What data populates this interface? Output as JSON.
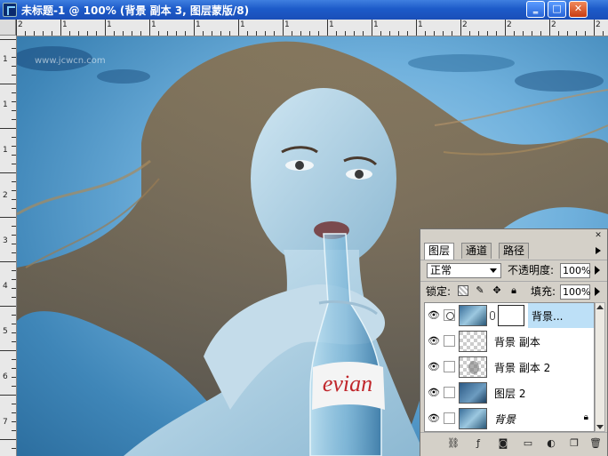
{
  "window": {
    "title": "未标题-1 @ 100% (背景 副本 3, 图层蒙版/8)",
    "buttons": {
      "minimize": "‗",
      "maximize": "□",
      "close": "✕"
    }
  },
  "watermark": "www.jcwcn.com",
  "rulers": {
    "top_labels": [
      "2",
      "1",
      "1",
      "1",
      "1",
      "1",
      "1",
      "1",
      "1",
      "1",
      "2",
      "2",
      "2",
      "2"
    ],
    "left_labels": [
      "1",
      "1",
      "1",
      "2",
      "3",
      "4",
      "5",
      "6",
      "7"
    ]
  },
  "canvas": {
    "photo_text": "evian"
  },
  "layers_panel": {
    "tabs": [
      "图层",
      "通道",
      "路径"
    ],
    "blend_mode": "正常",
    "opacity_label": "不透明度:",
    "opacity_value": "100%",
    "lock_label": "锁定:",
    "fill_label": "填充:",
    "fill_value": "100%",
    "layers": [
      {
        "name": "背景...",
        "selected": true,
        "has_mask": true
      },
      {
        "name": "背景 副本",
        "selected": false
      },
      {
        "name": "背景 副本 2",
        "selected": false
      },
      {
        "name": "图层 2",
        "selected": false
      },
      {
        "name": "背景",
        "selected": false,
        "locked": true,
        "italic": true
      }
    ],
    "bottom_icons": [
      "link-layers-icon",
      "layer-style-icon",
      "add-mask-icon",
      "new-group-icon",
      "adjustment-layer-icon",
      "new-layer-icon",
      "delete-layer-icon"
    ]
  }
}
